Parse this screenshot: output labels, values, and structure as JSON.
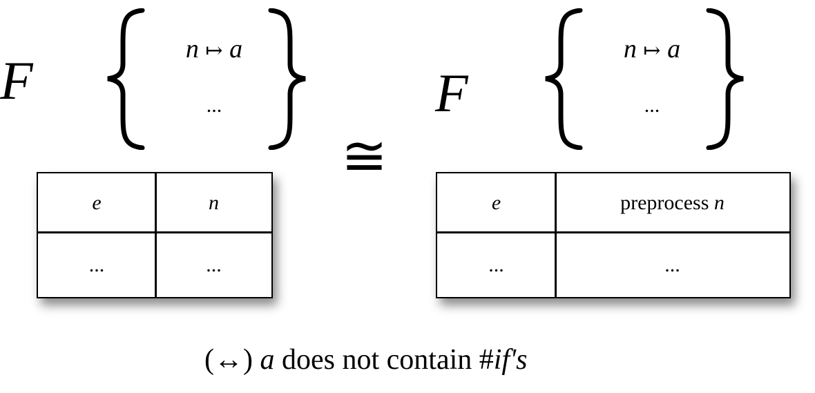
{
  "left": {
    "functor": "F",
    "mapping": {
      "n": "n",
      "arrow": "↦",
      "a": "a"
    },
    "ellipsis": "...",
    "table": {
      "header": [
        "e",
        "n"
      ],
      "row": [
        "...",
        "..."
      ]
    }
  },
  "relation": "≅",
  "right": {
    "functor": "F",
    "mapping": {
      "n": "n",
      "arrow": "↦",
      "a": "a"
    },
    "ellipsis": "...",
    "table": {
      "header_left": "e",
      "header_right_word": "preprocess",
      "header_right_var": "n",
      "row": [
        "...",
        "..."
      ]
    }
  },
  "caption": {
    "paren": "(↔)",
    "var": "a",
    "text": "does not contain #",
    "emph": "if",
    "tail": "'s"
  }
}
